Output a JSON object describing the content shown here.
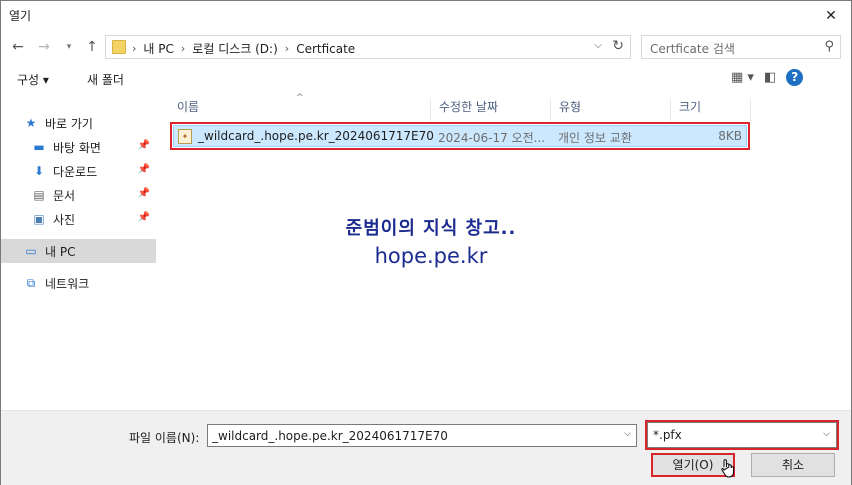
{
  "window": {
    "title": "열기",
    "close_glyph": "✕"
  },
  "address": {
    "crumbs": [
      "내 PC",
      "로컬 디스크 (D:)",
      "Certficate"
    ],
    "separator": "›",
    "search_placeholder": "Certficate 검색"
  },
  "toolbar": {
    "organize_label": "구성 ▾",
    "new_folder_label": "새 폴더"
  },
  "nav": {
    "quick_access": "바로 가기",
    "items": [
      {
        "label": "바탕 화면",
        "icon": "desktop-icon"
      },
      {
        "label": "다운로드",
        "icon": "download-icon"
      },
      {
        "label": "문서",
        "icon": "documents-icon"
      },
      {
        "label": "사진",
        "icon": "pictures-icon"
      }
    ],
    "this_pc": "내 PC",
    "network": "네트워크"
  },
  "columns": {
    "name": "이름",
    "date": "수정한 날짜",
    "type": "유형",
    "size": "크기"
  },
  "files": [
    {
      "name": "_wildcard_.hope.pe.kr_2024061717E70",
      "date": "2024-06-17 오전...",
      "type": "개인 정보 교환",
      "size": "8KB",
      "selected": true
    }
  ],
  "watermark": {
    "line1": "준범이의 지식 창고..",
    "line2": "hope.pe.kr"
  },
  "bottom": {
    "filename_label": "파일 이름(N):",
    "filename_value": "_wildcard_.hope.pe.kr_2024061717E70",
    "filter_value": "*.pfx",
    "open_label": "열기(O)",
    "cancel_label": "취소"
  },
  "colors": {
    "highlight": "#d7262b",
    "selection": "#cce8ff",
    "watermark": "#1c2b8f"
  }
}
